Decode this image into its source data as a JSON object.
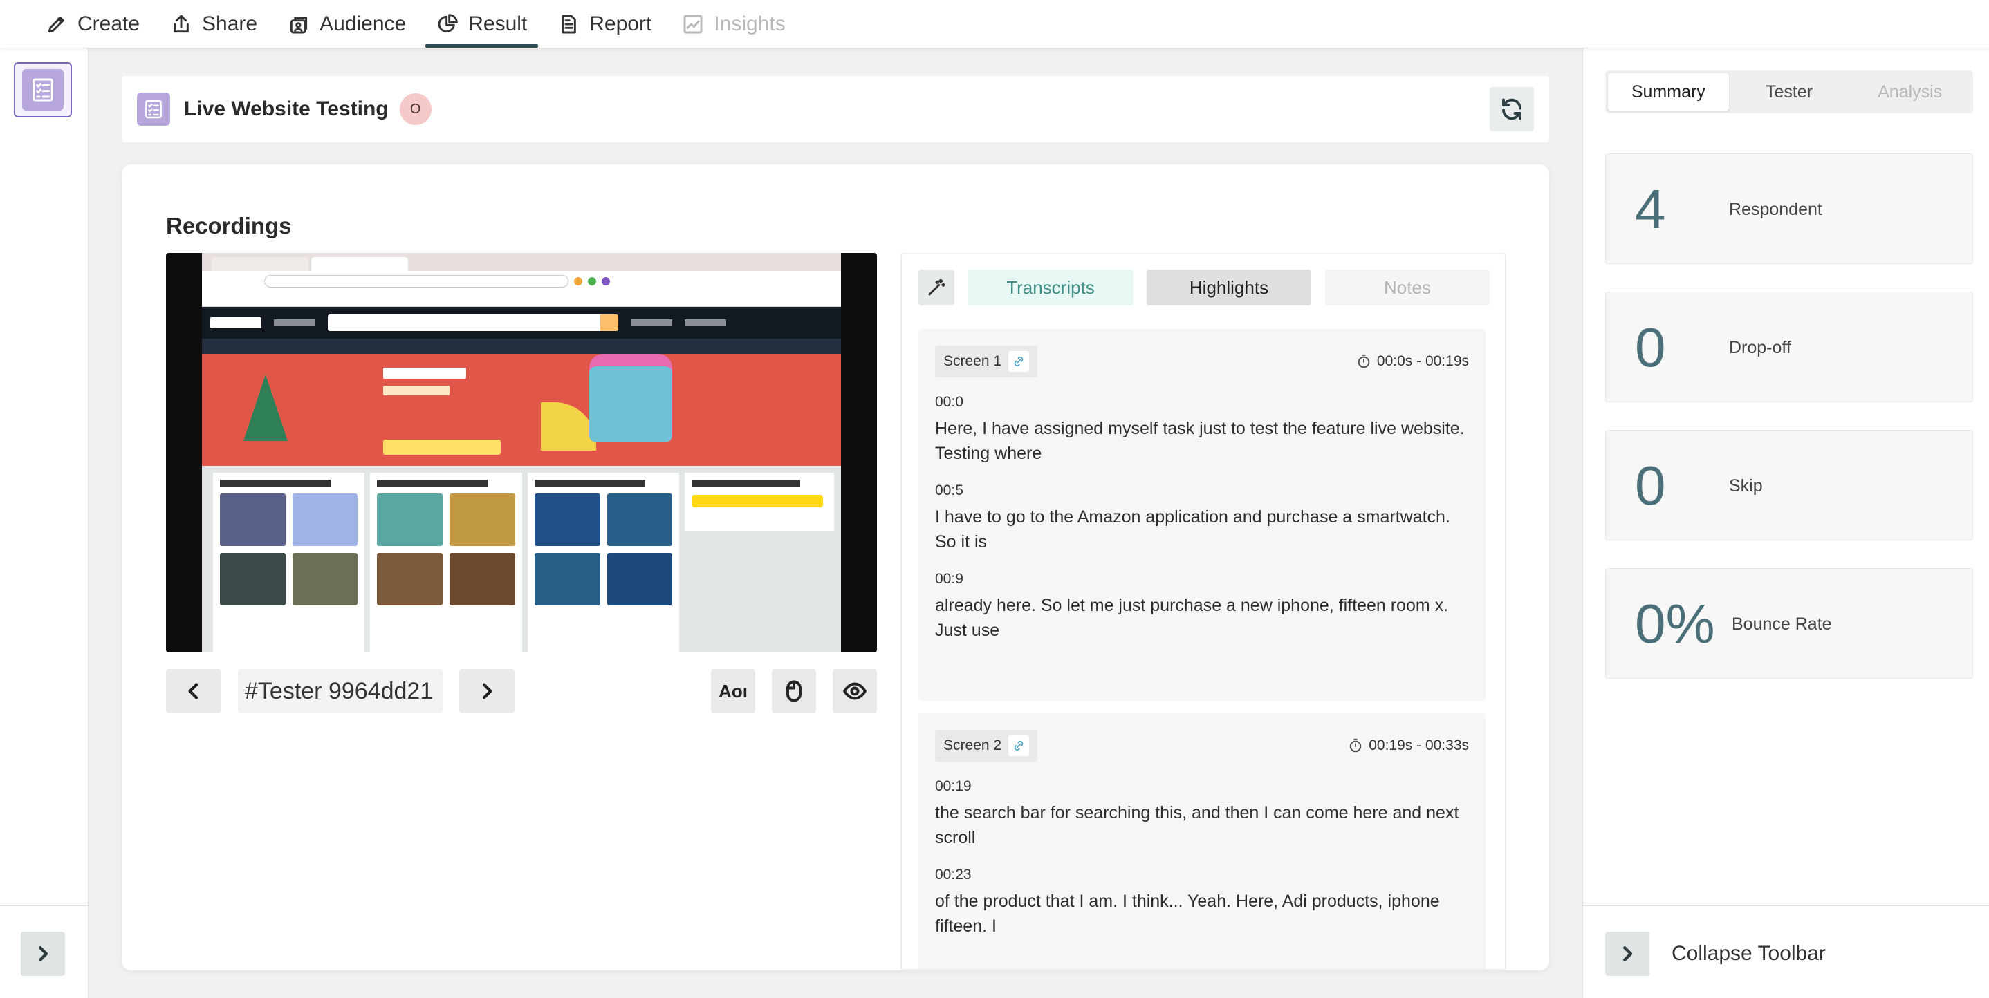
{
  "nav": {
    "items": [
      {
        "label": "Create",
        "icon": "pencil-icon"
      },
      {
        "label": "Share",
        "icon": "share-icon"
      },
      {
        "label": "Audience",
        "icon": "audience-icon"
      },
      {
        "label": "Result",
        "icon": "pie-chart-icon"
      },
      {
        "label": "Report",
        "icon": "report-icon"
      },
      {
        "label": "Insights",
        "icon": "trend-chart-icon"
      }
    ],
    "active": "Result",
    "disabled": "Insights"
  },
  "study": {
    "title": "Live Website Testing",
    "status_badge": "O"
  },
  "recordings": {
    "title": "Recordings",
    "tester_id": "#Tester 9964dd21",
    "aoi_label": "Aoı"
  },
  "transcript_panel": {
    "tabs": [
      "Transcripts",
      "Highlights",
      "Notes"
    ],
    "screens": [
      {
        "label": "Screen 1",
        "time_range": "00:0s - 00:19s",
        "entries": [
          {
            "ts": "00:0",
            "text": "Here, I have assigned myself task just to test the feature live website. Testing where"
          },
          {
            "ts": "00:5",
            "text": "I have to go to the Amazon application and purchase a smartwatch. So it is"
          },
          {
            "ts": "00:9",
            "text": "already here. So let me just purchase a new iphone, fifteen room x. Just use"
          }
        ]
      },
      {
        "label": "Screen 2",
        "time_range": "00:19s - 00:33s",
        "entries": [
          {
            "ts": "00:19",
            "text": "the search bar for searching this, and then I can come here and next scroll"
          },
          {
            "ts": "00:23",
            "text": "of the product that I am. I think... Yeah. Here, Adi products, iphone fifteen. I"
          }
        ]
      }
    ]
  },
  "summary": {
    "tabs": [
      "Summary",
      "Tester",
      "Analysis"
    ],
    "stats": [
      {
        "value": "4",
        "label": "Respondent"
      },
      {
        "value": "0",
        "label": "Drop-off"
      },
      {
        "value": "0",
        "label": "Skip"
      },
      {
        "value": "0%",
        "label": "Bounce Rate"
      }
    ]
  },
  "toolbar": {
    "collapse_label": "Collapse Toolbar"
  },
  "colors": {
    "accent": "#2e4a52",
    "stat_value": "#4b6f78",
    "study_icon": "#b7a6dc",
    "status_badge": "#f6c9c9",
    "transcripts_tab": "#e8f8f4"
  }
}
